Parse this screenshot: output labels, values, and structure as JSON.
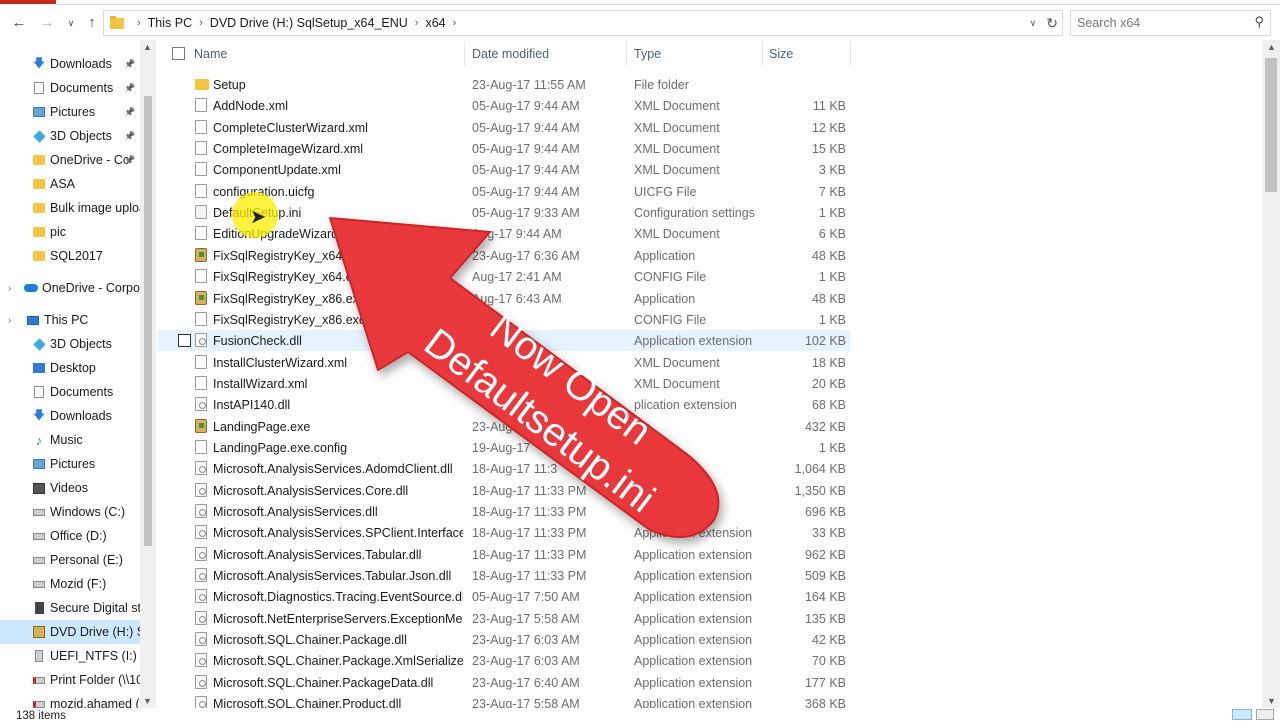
{
  "toolbar": {
    "back_icon": "back-arrow-icon",
    "forward_icon": "forward-arrow-icon",
    "recent_icon": "chevron-down-icon",
    "up_icon": "up-arrow-icon"
  },
  "address": {
    "crumbs": [
      "This PC",
      "DVD Drive (H:) SqlSetup_x64_ENU",
      "x64"
    ],
    "refresh_icon": "refresh-icon",
    "dropdown_icon": "chevron-down-icon"
  },
  "search": {
    "placeholder": "Search x64"
  },
  "sidebar": {
    "items": [
      {
        "label": "Downloads",
        "icon": "download-icon",
        "pinned": true
      },
      {
        "label": "Documents",
        "icon": "documents-icon",
        "pinned": true
      },
      {
        "label": "Pictures",
        "icon": "pictures-icon",
        "pinned": true
      },
      {
        "label": "3D Objects",
        "icon": "3d-objects-icon",
        "pinned": true
      },
      {
        "label": "OneDrive - Cc",
        "icon": "onedrive-icon",
        "pinned": true
      },
      {
        "label": "ASA",
        "icon": "folder-icon",
        "pinned": false
      },
      {
        "label": "Bulk image uploa",
        "icon": "folder-icon",
        "pinned": false
      },
      {
        "label": "pic",
        "icon": "folder-icon",
        "pinned": false
      },
      {
        "label": "SQL2017",
        "icon": "folder-icon",
        "pinned": false
      },
      {
        "label": "OneDrive - Corpo",
        "icon": "onedrive-cloud-icon",
        "pinned": false
      },
      {
        "label": "This PC",
        "icon": "computer-icon",
        "pinned": false
      },
      {
        "label": "3D Objects",
        "icon": "3d-objects-icon",
        "pinned": false
      },
      {
        "label": "Desktop",
        "icon": "desktop-icon",
        "pinned": false
      },
      {
        "label": "Documents",
        "icon": "documents-icon",
        "pinned": false
      },
      {
        "label": "Downloads",
        "icon": "download-icon",
        "pinned": false
      },
      {
        "label": "Music",
        "icon": "music-icon",
        "pinned": false
      },
      {
        "label": "Pictures",
        "icon": "pictures-icon",
        "pinned": false
      },
      {
        "label": "Videos",
        "icon": "videos-icon",
        "pinned": false
      },
      {
        "label": "Windows (C:)",
        "icon": "drive-icon",
        "pinned": false
      },
      {
        "label": "Office (D:)",
        "icon": "drive-icon",
        "pinned": false
      },
      {
        "label": "Personal (E:)",
        "icon": "drive-icon",
        "pinned": false
      },
      {
        "label": "Mozid (F:)",
        "icon": "drive-icon",
        "pinned": false
      },
      {
        "label": "Secure Digital st",
        "icon": "sd-card-icon",
        "pinned": false
      },
      {
        "label": "DVD Drive (H:) S",
        "icon": "dvd-drive-icon",
        "pinned": false,
        "selected": true
      },
      {
        "label": "UEFI_NTFS (I:)",
        "icon": "usb-drive-icon",
        "pinned": false
      },
      {
        "label": "Print Folder (\\\\10",
        "icon": "network-drive-icon",
        "pinned": false
      },
      {
        "label": "mozid.ahamed (",
        "icon": "network-drive-icon",
        "pinned": false
      }
    ]
  },
  "columns": {
    "name": "Name",
    "date": "Date modified",
    "type": "Type",
    "size": "Size"
  },
  "files": [
    {
      "name": "Setup",
      "date": "23-Aug-17 11:55 AM",
      "type": "File folder",
      "size": "",
      "kind": "folder"
    },
    {
      "name": "AddNode.xml",
      "date": "05-Aug-17 9:44 AM",
      "type": "XML Document",
      "size": "11 KB",
      "kind": "doc"
    },
    {
      "name": "CompleteClusterWizard.xml",
      "date": "05-Aug-17 9:44 AM",
      "type": "XML Document",
      "size": "12 KB",
      "kind": "doc"
    },
    {
      "name": "CompleteImageWizard.xml",
      "date": "05-Aug-17 9:44 AM",
      "type": "XML Document",
      "size": "15 KB",
      "kind": "doc"
    },
    {
      "name": "ComponentUpdate.xml",
      "date": "05-Aug-17 9:44 AM",
      "type": "XML Document",
      "size": "3 KB",
      "kind": "doc"
    },
    {
      "name": "configuration.uicfg",
      "date": "05-Aug-17 9:44 AM",
      "type": "UICFG File",
      "size": "7 KB",
      "kind": "doc"
    },
    {
      "name": "DefaultSetup.ini",
      "date": "05-Aug-17 9:33 AM",
      "type": "Configuration settings",
      "size": "1 KB",
      "kind": "ini"
    },
    {
      "name": "EditionUpgradeWizard.",
      "date": "Aug-17 9:44 AM",
      "type": "XML Document",
      "size": "6 KB",
      "kind": "doc"
    },
    {
      "name": "FixSqlRegistryKey_x64.ex",
      "date": "23-Aug-17 6:36 AM",
      "type": "Application",
      "size": "48 KB",
      "kind": "app"
    },
    {
      "name": "FixSqlRegistryKey_x64.exe",
      "date": "Aug-17 2:41 AM",
      "type": "CONFIG File",
      "size": "1 KB",
      "kind": "doc"
    },
    {
      "name": "FixSqlRegistryKey_x86.exe",
      "date": "Aug-17 6:43 AM",
      "type": "Application",
      "size": "48 KB",
      "kind": "app"
    },
    {
      "name": "FixSqlRegistryKey_x86.exe.co",
      "date": "41 AM",
      "type": "CONFIG File",
      "size": "1 KB",
      "kind": "doc"
    },
    {
      "name": "FusionCheck.dll",
      "date": "AM",
      "type": "Application extension",
      "size": "102 KB",
      "kind": "dll",
      "hover": true
    },
    {
      "name": "InstallClusterWizard.xml",
      "date": "",
      "type": "XML Document",
      "size": "18 KB",
      "kind": "doc"
    },
    {
      "name": "InstallWizard.xml",
      "date": "",
      "type": "XML Document",
      "size": "20 KB",
      "kind": "doc"
    },
    {
      "name": "InstAPI140.dll",
      "date": "",
      "type": "plication extension",
      "size": "68 KB",
      "kind": "dll"
    },
    {
      "name": "LandingPage.exe",
      "date": "23-Aug-17",
      "type": "ion",
      "size": "432 KB",
      "kind": "app"
    },
    {
      "name": "LandingPage.exe.config",
      "date": "19-Aug-17",
      "type": "",
      "size": "1 KB",
      "kind": "doc"
    },
    {
      "name": "Microsoft.AnalysisServices.AdomdClient.dll",
      "date": "18-Aug-17 11:3",
      "type": "ension",
      "size": "1,064 KB",
      "kind": "dll"
    },
    {
      "name": "Microsoft.AnalysisServices.Core.dll",
      "date": "18-Aug-17 11:33 PM",
      "type": "ension",
      "size": "1,350 KB",
      "kind": "dll"
    },
    {
      "name": "Microsoft.AnalysisServices.dll",
      "date": "18-Aug-17 11:33 PM",
      "type": "ension",
      "size": "696 KB",
      "kind": "dll"
    },
    {
      "name": "Microsoft.AnalysisServices.SPClient.Interfaces...",
      "date": "18-Aug-17 11:33 PM",
      "type": "Application extension",
      "size": "33 KB",
      "kind": "dll"
    },
    {
      "name": "Microsoft.AnalysisServices.Tabular.dll",
      "date": "18-Aug-17 11:33 PM",
      "type": "Application extension",
      "size": "962 KB",
      "kind": "dll"
    },
    {
      "name": "Microsoft.AnalysisServices.Tabular.Json.dll",
      "date": "18-Aug-17 11:33 PM",
      "type": "Application extension",
      "size": "509 KB",
      "kind": "dll"
    },
    {
      "name": "Microsoft.Diagnostics.Tracing.EventSource.dll",
      "date": "05-Aug-17 7:50 AM",
      "type": "Application extension",
      "size": "164 KB",
      "kind": "dll"
    },
    {
      "name": "Microsoft.NetEnterpriseServers.ExceptionMe...",
      "date": "23-Aug-17 5:58 AM",
      "type": "Application extension",
      "size": "135 KB",
      "kind": "dll"
    },
    {
      "name": "Microsoft.SQL.Chainer.Package.dll",
      "date": "23-Aug-17 6:03 AM",
      "type": "Application extension",
      "size": "42 KB",
      "kind": "dll"
    },
    {
      "name": "Microsoft.SQL.Chainer.Package.XmlSerializers...",
      "date": "23-Aug-17 6:03 AM",
      "type": "Application extension",
      "size": "70 KB",
      "kind": "dll"
    },
    {
      "name": "Microsoft.SQL.Chainer.PackageData.dll",
      "date": "23-Aug-17 6:40 AM",
      "type": "Application extension",
      "size": "177 KB",
      "kind": "dll"
    },
    {
      "name": "Microsoft.SQL.Chainer.Product.dll",
      "date": "23-Aug-17 5:58 AM",
      "type": "Application extension",
      "size": "368 KB",
      "kind": "dll"
    }
  ],
  "status": {
    "item_count": "138 items"
  },
  "overlay": {
    "line1": "Now Open",
    "line2": "Defaultsetup.ini",
    "arrow_color": "#e8393a"
  },
  "colors": {
    "accent": "#cce8ff",
    "hover": "#e5f3ff",
    "header_text": "#4c607a"
  }
}
